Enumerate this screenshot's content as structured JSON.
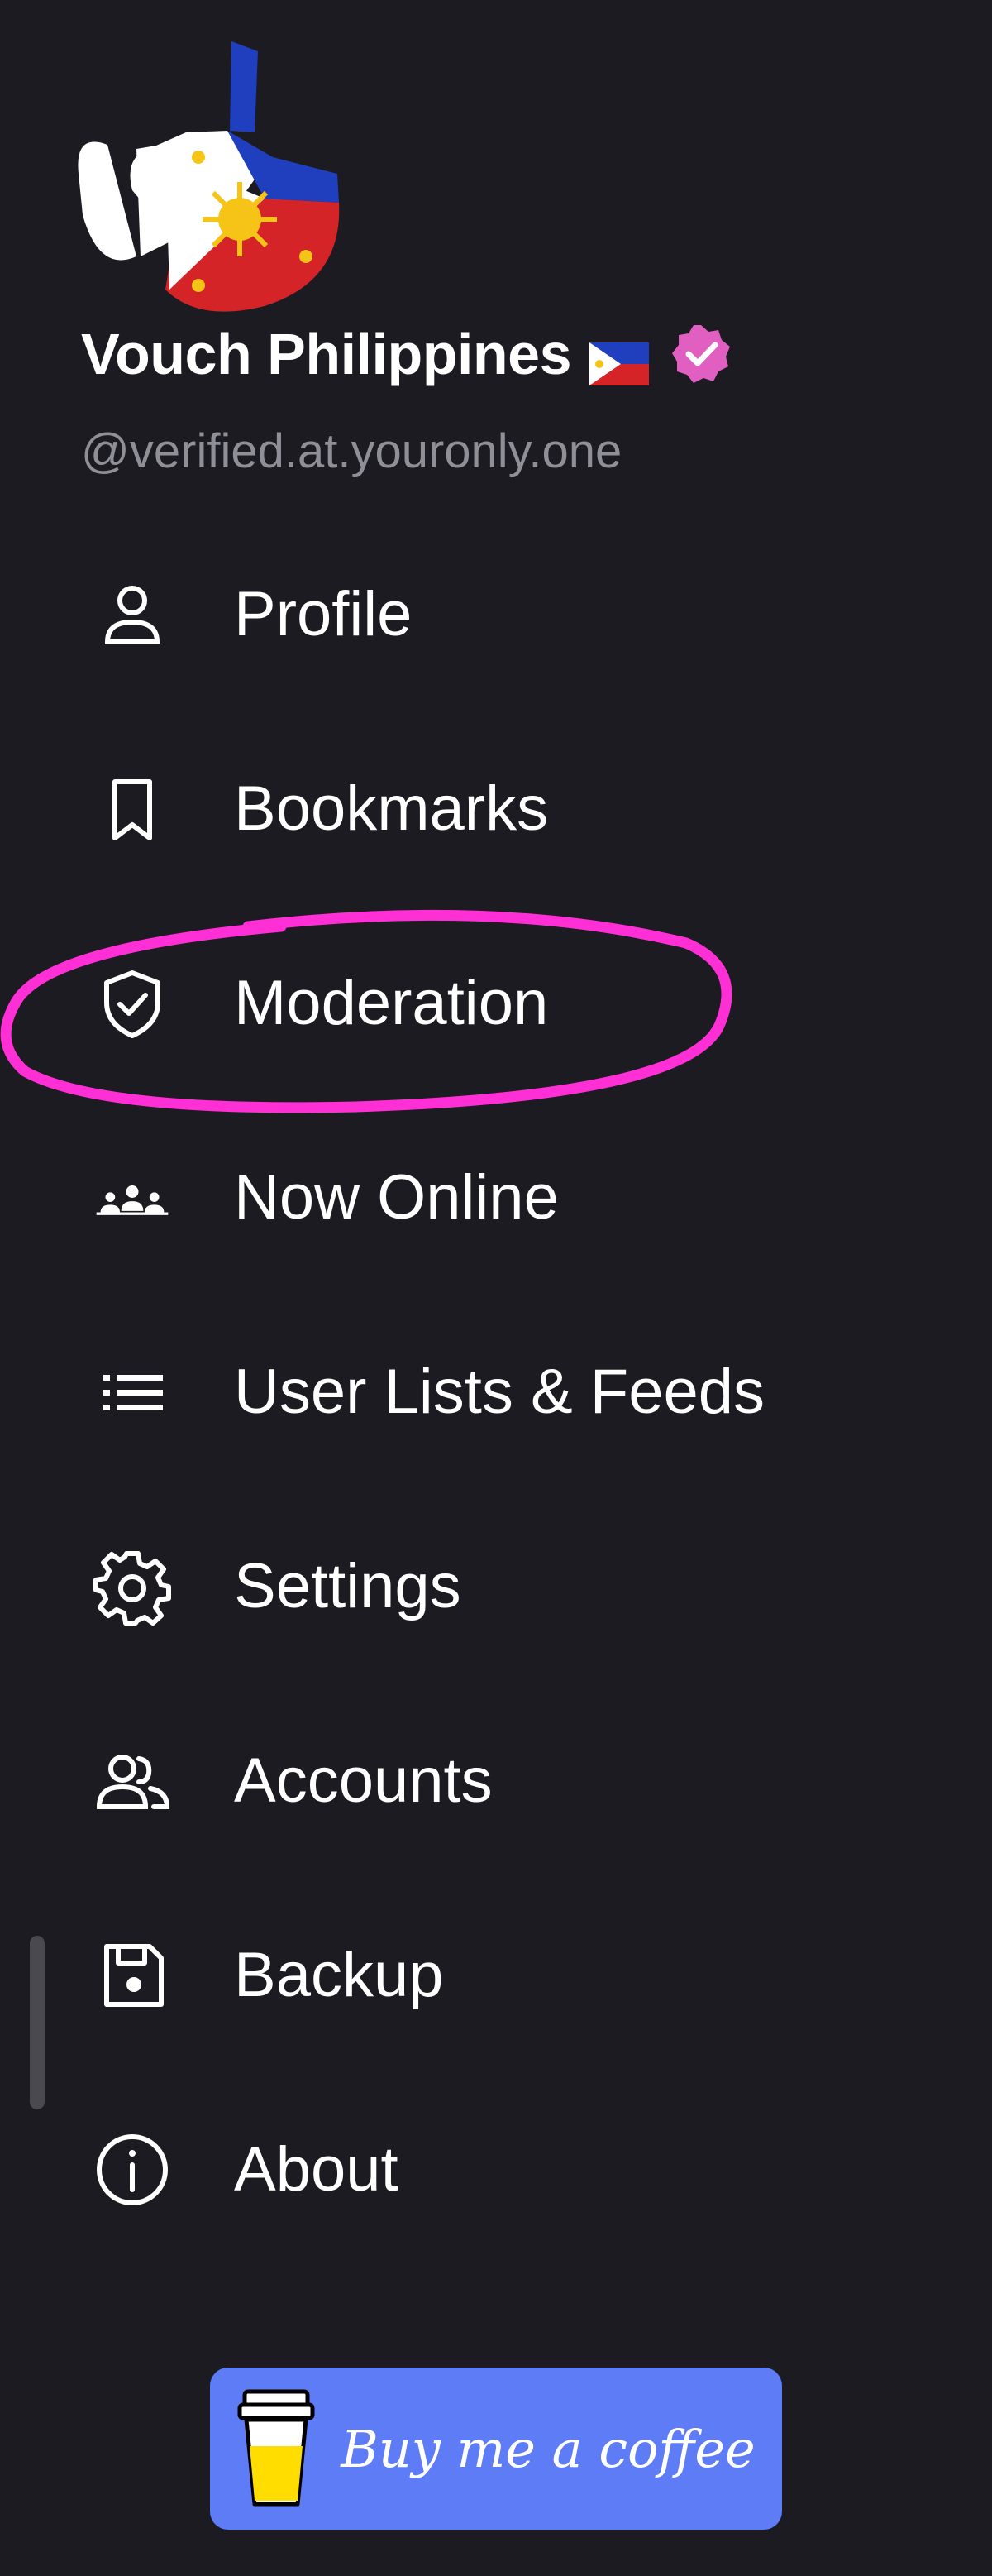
{
  "profile": {
    "display_name": "Vouch Philippines",
    "handle": "@verified.at.youronly.one",
    "verified_badge_color": "#e05fc0"
  },
  "menu": {
    "items": [
      {
        "label": "Profile",
        "icon": "person-icon"
      },
      {
        "label": "Bookmarks",
        "icon": "bookmark-icon"
      },
      {
        "label": "Moderation",
        "icon": "shield-check-icon"
      },
      {
        "label": "Now Online",
        "icon": "group-icon"
      },
      {
        "label": "User Lists & Feeds",
        "icon": "list-icon"
      },
      {
        "label": "Settings",
        "icon": "gear-icon"
      },
      {
        "label": "Accounts",
        "icon": "accounts-icon"
      },
      {
        "label": "Backup",
        "icon": "save-icon"
      },
      {
        "label": "About",
        "icon": "info-icon"
      }
    ]
  },
  "coffee_button": {
    "label": "Buy me a coffee",
    "color": "#5f7cf7"
  },
  "annotation": {
    "color": "#ff2fd6"
  }
}
